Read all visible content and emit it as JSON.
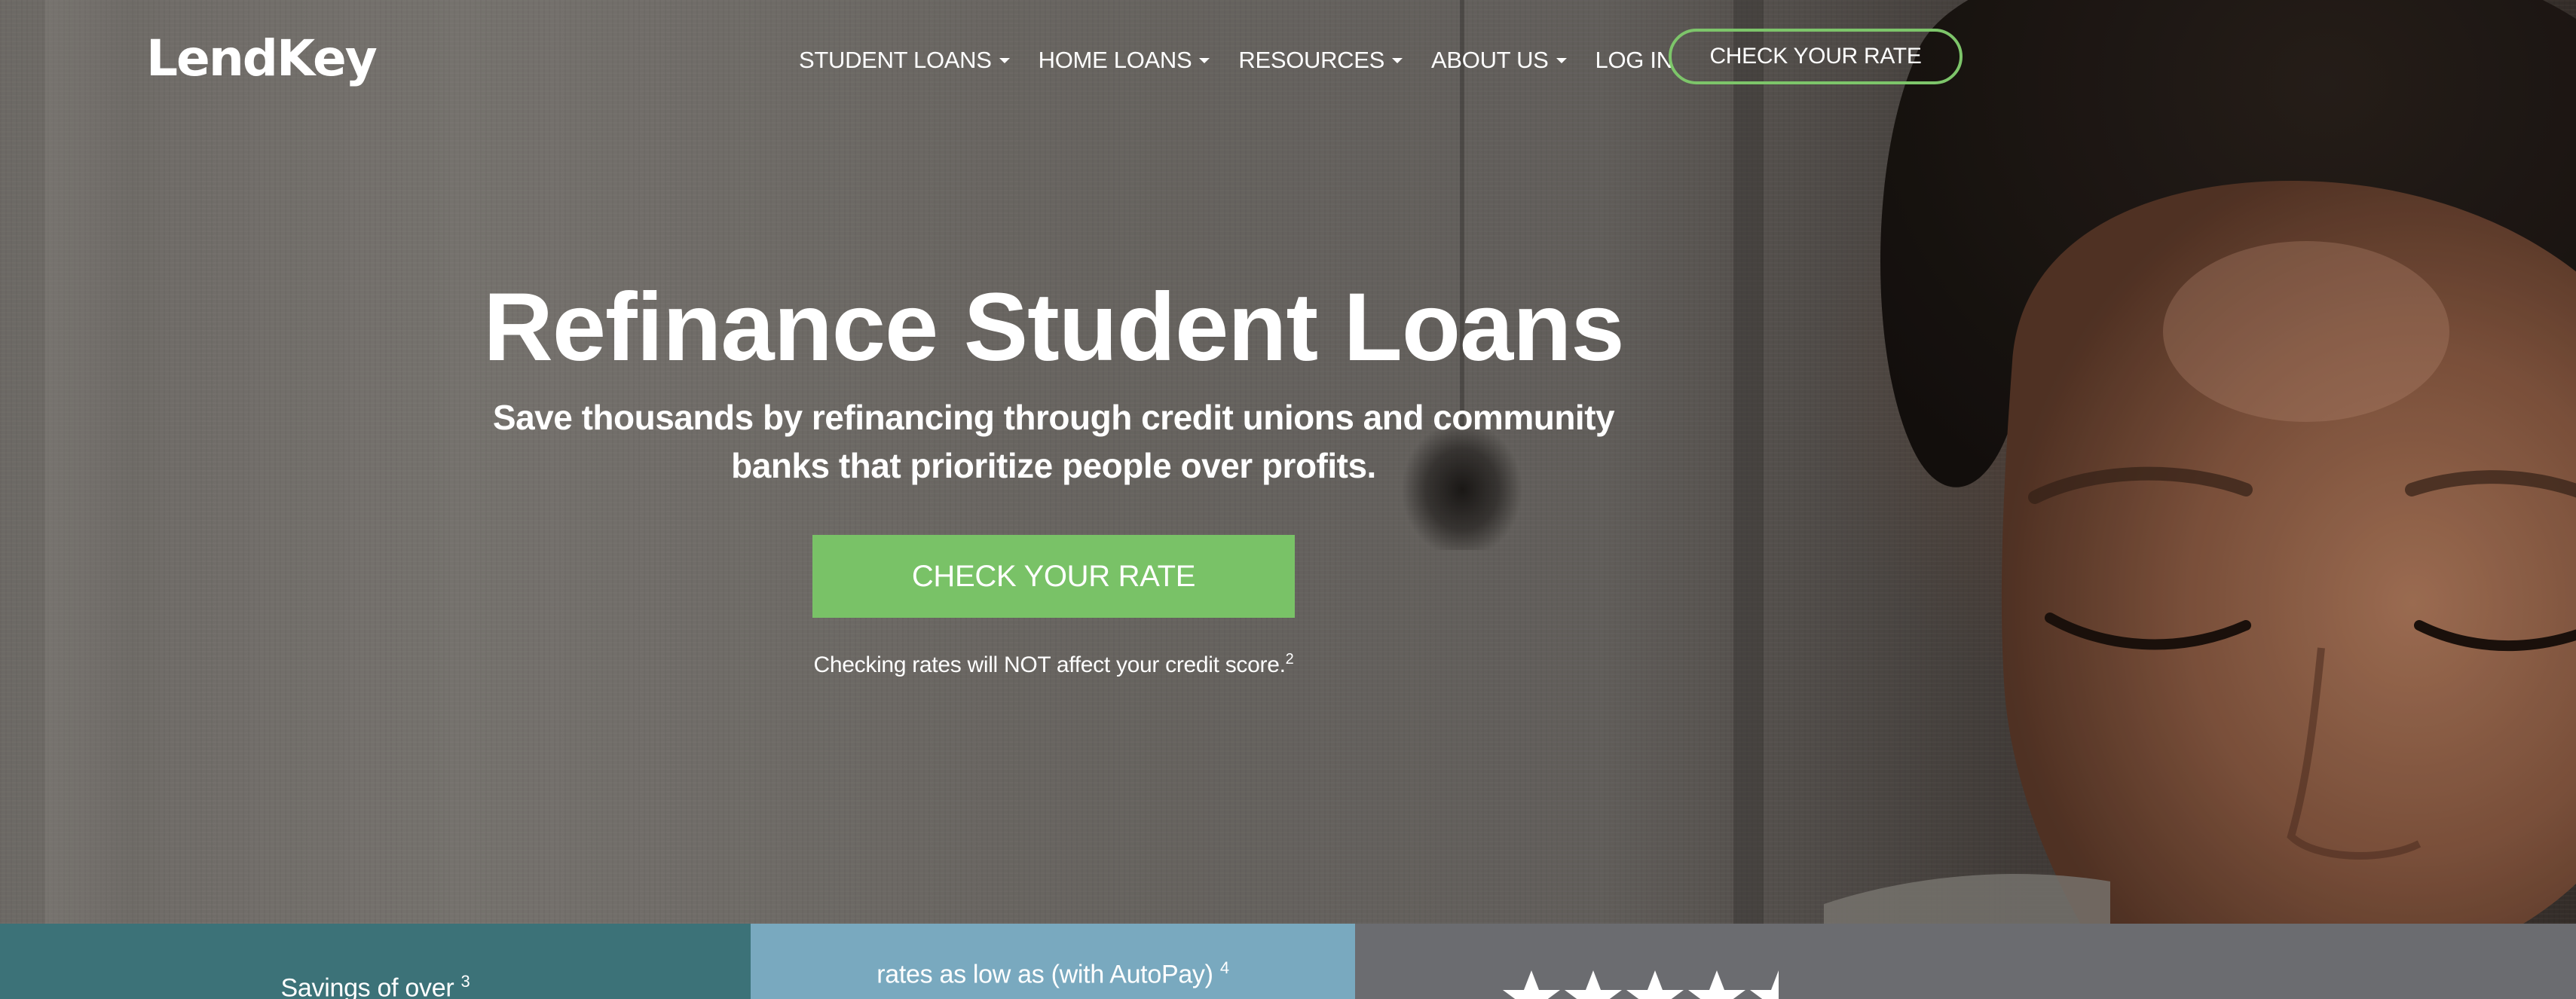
{
  "nav": {
    "logo": "LendKey",
    "items": [
      {
        "label": "STUDENT LOANS",
        "dropdown": true
      },
      {
        "label": "HOME LOANS",
        "dropdown": true
      },
      {
        "label": "RESOURCES",
        "dropdown": true
      },
      {
        "label": "ABOUT US",
        "dropdown": true
      },
      {
        "label": "LOG IN",
        "dropdown": false
      }
    ],
    "cta_label": "CHECK YOUR RATE"
  },
  "hero": {
    "title": "Refinance Student Loans",
    "subtitle": "Save thousands by refinancing through credit unions and community banks that prioritize people over profits.",
    "cta_label": "CHECK YOUR RATE",
    "note": "Checking rates will NOT affect your credit score.",
    "note_sup": "2"
  },
  "stats": {
    "savings": {
      "label": "Savings of over",
      "sup": "3"
    },
    "rates": {
      "label": "rates as low as (with AutoPay)",
      "sup": "4"
    },
    "reviews": {
      "stars": 4.5
    }
  },
  "colors": {
    "accent_green": "#79c267",
    "nav_cta_border": "#7dc56a",
    "stat_savings_bg": "#3c7278",
    "stat_rates_bg": "#79a9bf",
    "stat_reviews_bg": "#6b6c70"
  }
}
